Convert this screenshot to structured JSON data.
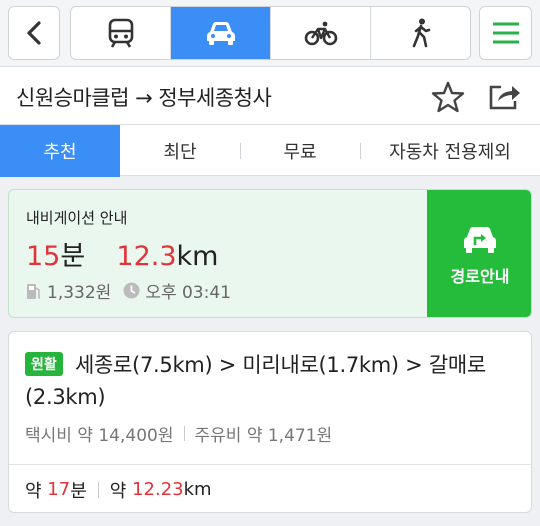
{
  "topbar": {
    "back_icon": "chevron-left-icon",
    "menu_icon": "hamburger-menu-icon",
    "modes": [
      {
        "name": "transit",
        "icon": "bus-icon",
        "active": false
      },
      {
        "name": "car",
        "icon": "car-icon",
        "active": true
      },
      {
        "name": "bike",
        "icon": "bicycle-icon",
        "active": false
      },
      {
        "name": "walk",
        "icon": "walking-person-icon",
        "active": false
      }
    ]
  },
  "route_title": "신원승마클럽 → 정부세종청사",
  "tabs": [
    "추천",
    "최단",
    "무료",
    "자동차 전용제외"
  ],
  "navigation": {
    "label": "내비게이션 안내",
    "time_value": "15",
    "time_unit": "분",
    "distance_value": "12.3",
    "distance_unit": "km",
    "fuel_cost": "1,332원",
    "arrival": "오후 03:41",
    "guide_button": "경로안내"
  },
  "route": {
    "badge": "원활",
    "path": "세종로(7.5km) > 미리내로(1.7km) > 갈매로(2.3km)",
    "taxi_fare": "택시비 약 14,400원",
    "fuel_fare": "주유비 약 1,471원",
    "about": "약",
    "time_value": "17",
    "time_unit": "분",
    "distance_value": "12.23",
    "distance_unit": "km"
  },
  "colors": {
    "accent_blue": "#3a8ef6",
    "green": "#25bc3c",
    "red": "#e1333a"
  }
}
